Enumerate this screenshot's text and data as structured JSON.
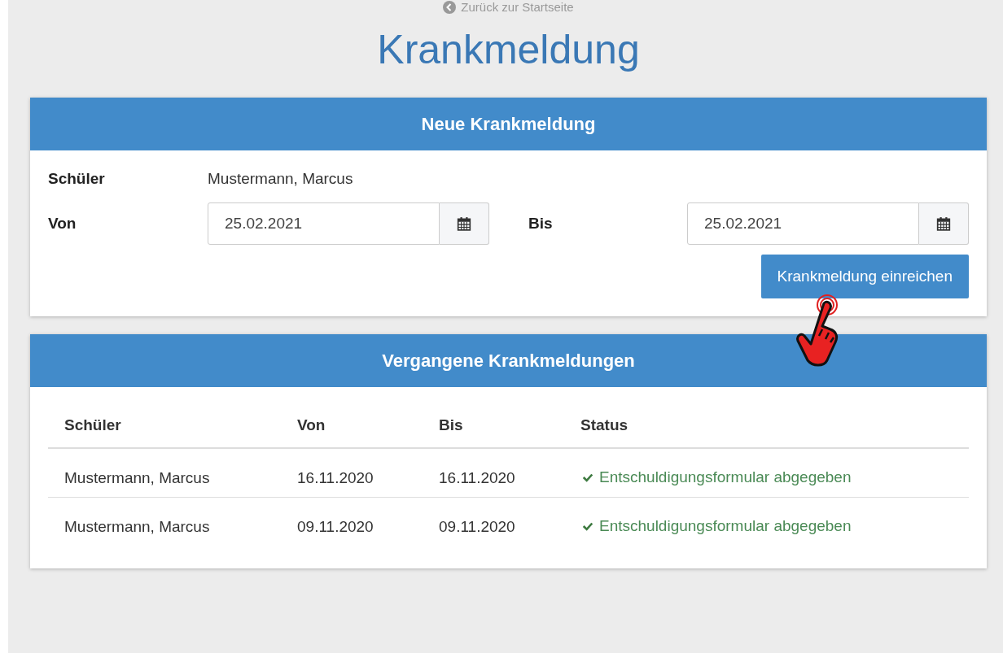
{
  "back_link": {
    "label": "Zurück zur Startseite"
  },
  "page_title": "Krankmeldung",
  "new_report": {
    "header": "Neue Krankmeldung",
    "student_label": "Schüler",
    "student_value": "Mustermann, Marcus",
    "from_label": "Von",
    "from_value": "25.02.2021",
    "to_label": "Bis",
    "to_value": "25.02.2021",
    "submit_button": "Krankmeldung einreichen"
  },
  "past_reports": {
    "header": "Vergangene Krankmeldungen",
    "columns": [
      "Schüler",
      "Von",
      "Bis",
      "Status"
    ],
    "rows": [
      {
        "student": "Mustermann, Marcus",
        "from": "16.11.2020",
        "to": "16.11.2020",
        "status": "Entschuldigungsformular abgegeben"
      },
      {
        "student": "Mustermann, Marcus",
        "from": "09.11.2020",
        "to": "09.11.2020",
        "status": "Entschuldigungsformular abgegeben"
      }
    ]
  }
}
